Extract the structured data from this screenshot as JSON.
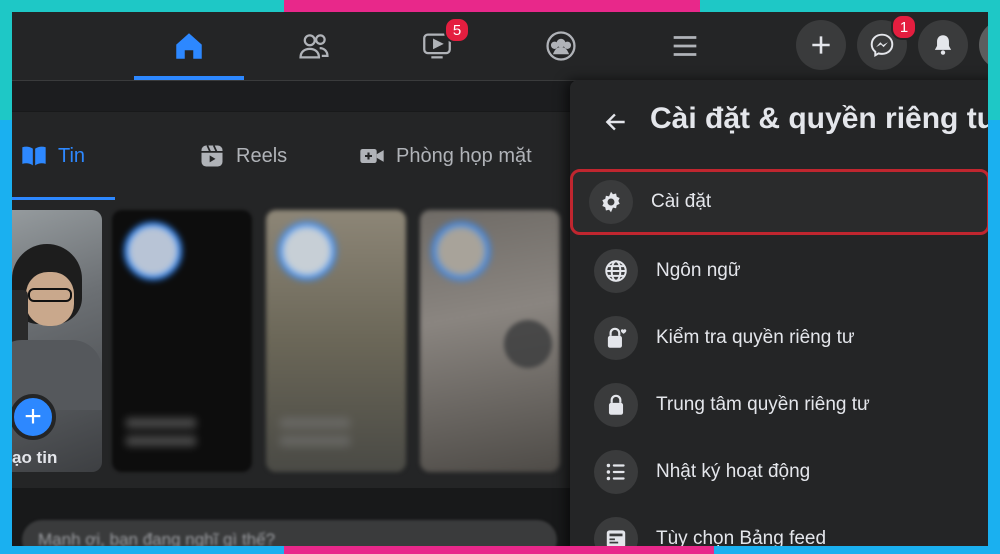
{
  "nav": {
    "tabs": [
      {
        "name": "home",
        "icon": "home-icon",
        "active": true
      },
      {
        "name": "friends",
        "icon": "friends-icon"
      },
      {
        "name": "watch",
        "icon": "video-icon",
        "badge": "5"
      },
      {
        "name": "groups",
        "icon": "groups-icon"
      },
      {
        "name": "menu",
        "icon": "hamburger-icon"
      }
    ],
    "messenger_badge": "1",
    "accent": "#2d88ff",
    "badge_color": "#e41e3f"
  },
  "feed_tabs": [
    {
      "label": "Tin",
      "icon": "book-icon",
      "active": true
    },
    {
      "label": "Reels",
      "icon": "reels-icon"
    },
    {
      "label": "Phòng họp mặt",
      "icon": "video-camera-icon"
    }
  ],
  "stories": {
    "create_label": "ạo tin"
  },
  "composer": {
    "placeholder": "Mạnh ơi, bạn đang nghĩ gì thế?"
  },
  "settings_panel": {
    "title": "Cài đặt & quyền riêng tư",
    "items": [
      {
        "label": "Cài đặt",
        "icon": "gear-icon",
        "highlighted": true
      },
      {
        "label": "Ngôn ngữ",
        "icon": "globe-icon"
      },
      {
        "label": "Kiểm tra quyền riêng tư",
        "icon": "lock-heart-icon"
      },
      {
        "label": "Trung tâm quyền riêng tư",
        "icon": "lock-icon"
      },
      {
        "label": "Nhật ký hoạt động",
        "icon": "list-icon"
      },
      {
        "label": "Tùy chọn Bảng feed",
        "icon": "feed-icon"
      }
    ],
    "highlight_color": "#c0262f"
  }
}
